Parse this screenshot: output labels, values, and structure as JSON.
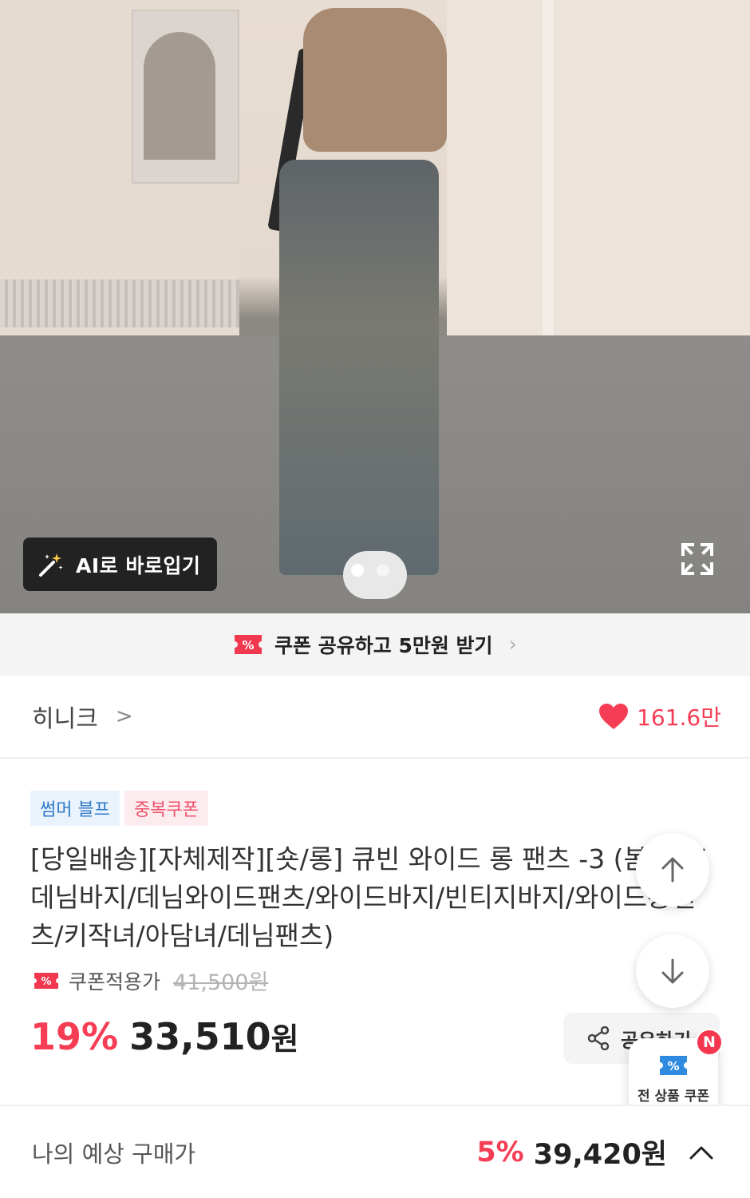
{
  "hero": {
    "ai_button_label": "AI로 바로입기",
    "slides_total": 2,
    "active_slide": 1
  },
  "coupon_banner": {
    "label": "쿠폰 공유하고 5만원 받기",
    "chevron": "›"
  },
  "brand": {
    "name": "히니크",
    "chevron": ">",
    "likes": "161.6만"
  },
  "badges": [
    {
      "label": "썸머 블프"
    },
    {
      "label": "중복쿠폰"
    }
  ],
  "product": {
    "title": "[당일배송][자체제작][숏/롱] 큐빈 와이드 롱 팬츠 -3 (봄신상/데님바지/데님와이드팬츠/와이드바지/빈티지바지/와이드롱팬츠/키작녀/아담녀/데님팬츠)",
    "coupon_label": "쿠폰적용가",
    "original_price": "41,500원",
    "discount_rate": "19%",
    "price": "33,510",
    "price_unit": "원"
  },
  "share": {
    "label": "공유하기"
  },
  "all_coupon": {
    "label": "전 상품 쿠폰",
    "badge": "N"
  },
  "bottom_bar": {
    "label": "나의 예상 구매가",
    "rate": "5%",
    "price": "39,420원"
  },
  "colors": {
    "accent_red": "#f53e55",
    "badge_blue": "#2f78c9",
    "badge_pink": "#f0526a"
  }
}
